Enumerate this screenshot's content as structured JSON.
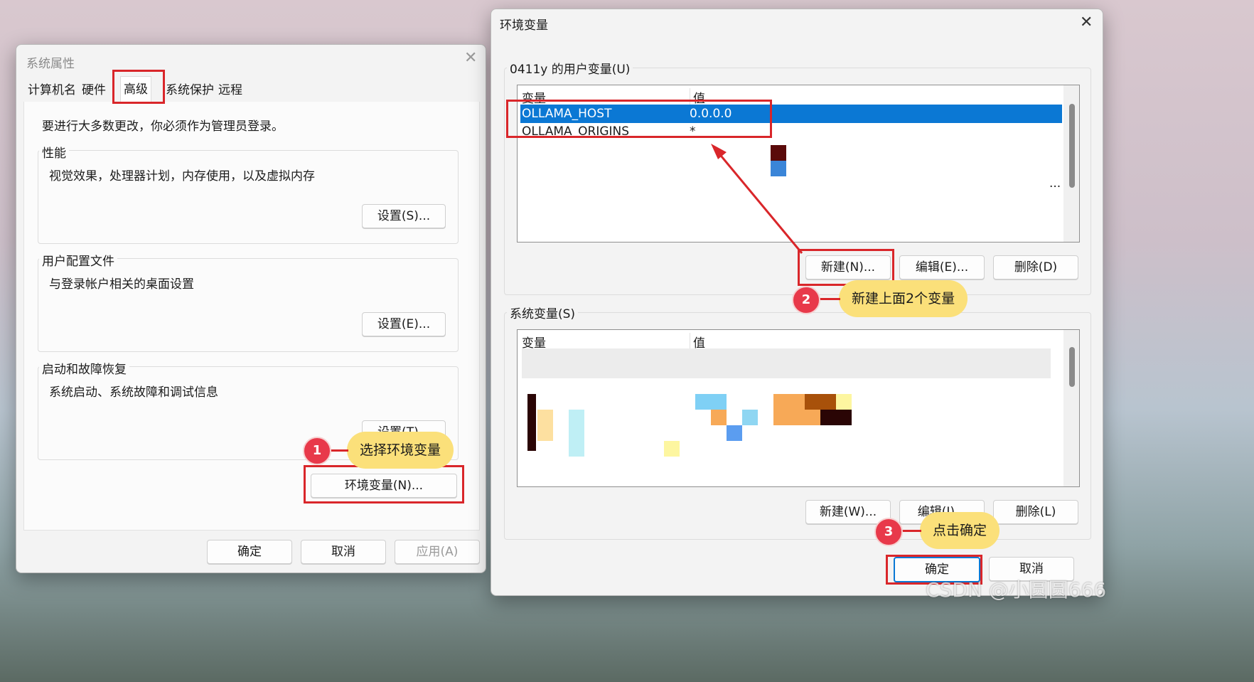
{
  "sys_props": {
    "title": "系统属性",
    "tabs": [
      "计算机名",
      "硬件",
      "高级",
      "系统保护",
      "远程"
    ],
    "admin_notice": "要进行大多数更改，你必须作为管理员登录。",
    "performance": {
      "label": "性能",
      "desc": "视觉效果，处理器计划，内存使用，以及虚拟内存",
      "button": "设置(S)..."
    },
    "profile": {
      "label": "用户配置文件",
      "desc": "与登录帐户相关的桌面设置",
      "button": "设置(E)..."
    },
    "startup": {
      "label": "启动和故障恢复",
      "desc": "系统启动、系统故障和调试信息",
      "button": "设置(T)..."
    },
    "env_button": "环境变量(N)...",
    "ok": "确定",
    "cancel": "取消",
    "apply": "应用(A)"
  },
  "env_vars": {
    "title": "环境变量",
    "user_group_label": "0411y 的用户变量(U)",
    "col_var": "变量",
    "col_val": "值",
    "user_rows": [
      {
        "name": "OLLAMA_HOST",
        "value": "0.0.0.0"
      },
      {
        "name": "OLLAMA_ORIGINS",
        "value": "*"
      }
    ],
    "ellipsis": "...",
    "user_new": "新建(N)...",
    "user_edit": "编辑(E)...",
    "user_delete": "删除(D)",
    "system_group_label": "系统变量(S)",
    "sys_new": "新建(W)...",
    "sys_edit": "编辑(I)...",
    "sys_delete": "删除(L)",
    "ok": "确定",
    "cancel": "取消"
  },
  "annotations": [
    {
      "num": "1",
      "text": "选择环境变量"
    },
    {
      "num": "2",
      "text": "新建上面2个变量"
    },
    {
      "num": "3",
      "text": "点击确定"
    }
  ],
  "watermark": "CSDN @小圆圆666",
  "colors": {
    "selection": "#0b78d4",
    "highlight_box": "#d9262a",
    "callout": "#fbe07a",
    "badge": "#e8394a"
  }
}
